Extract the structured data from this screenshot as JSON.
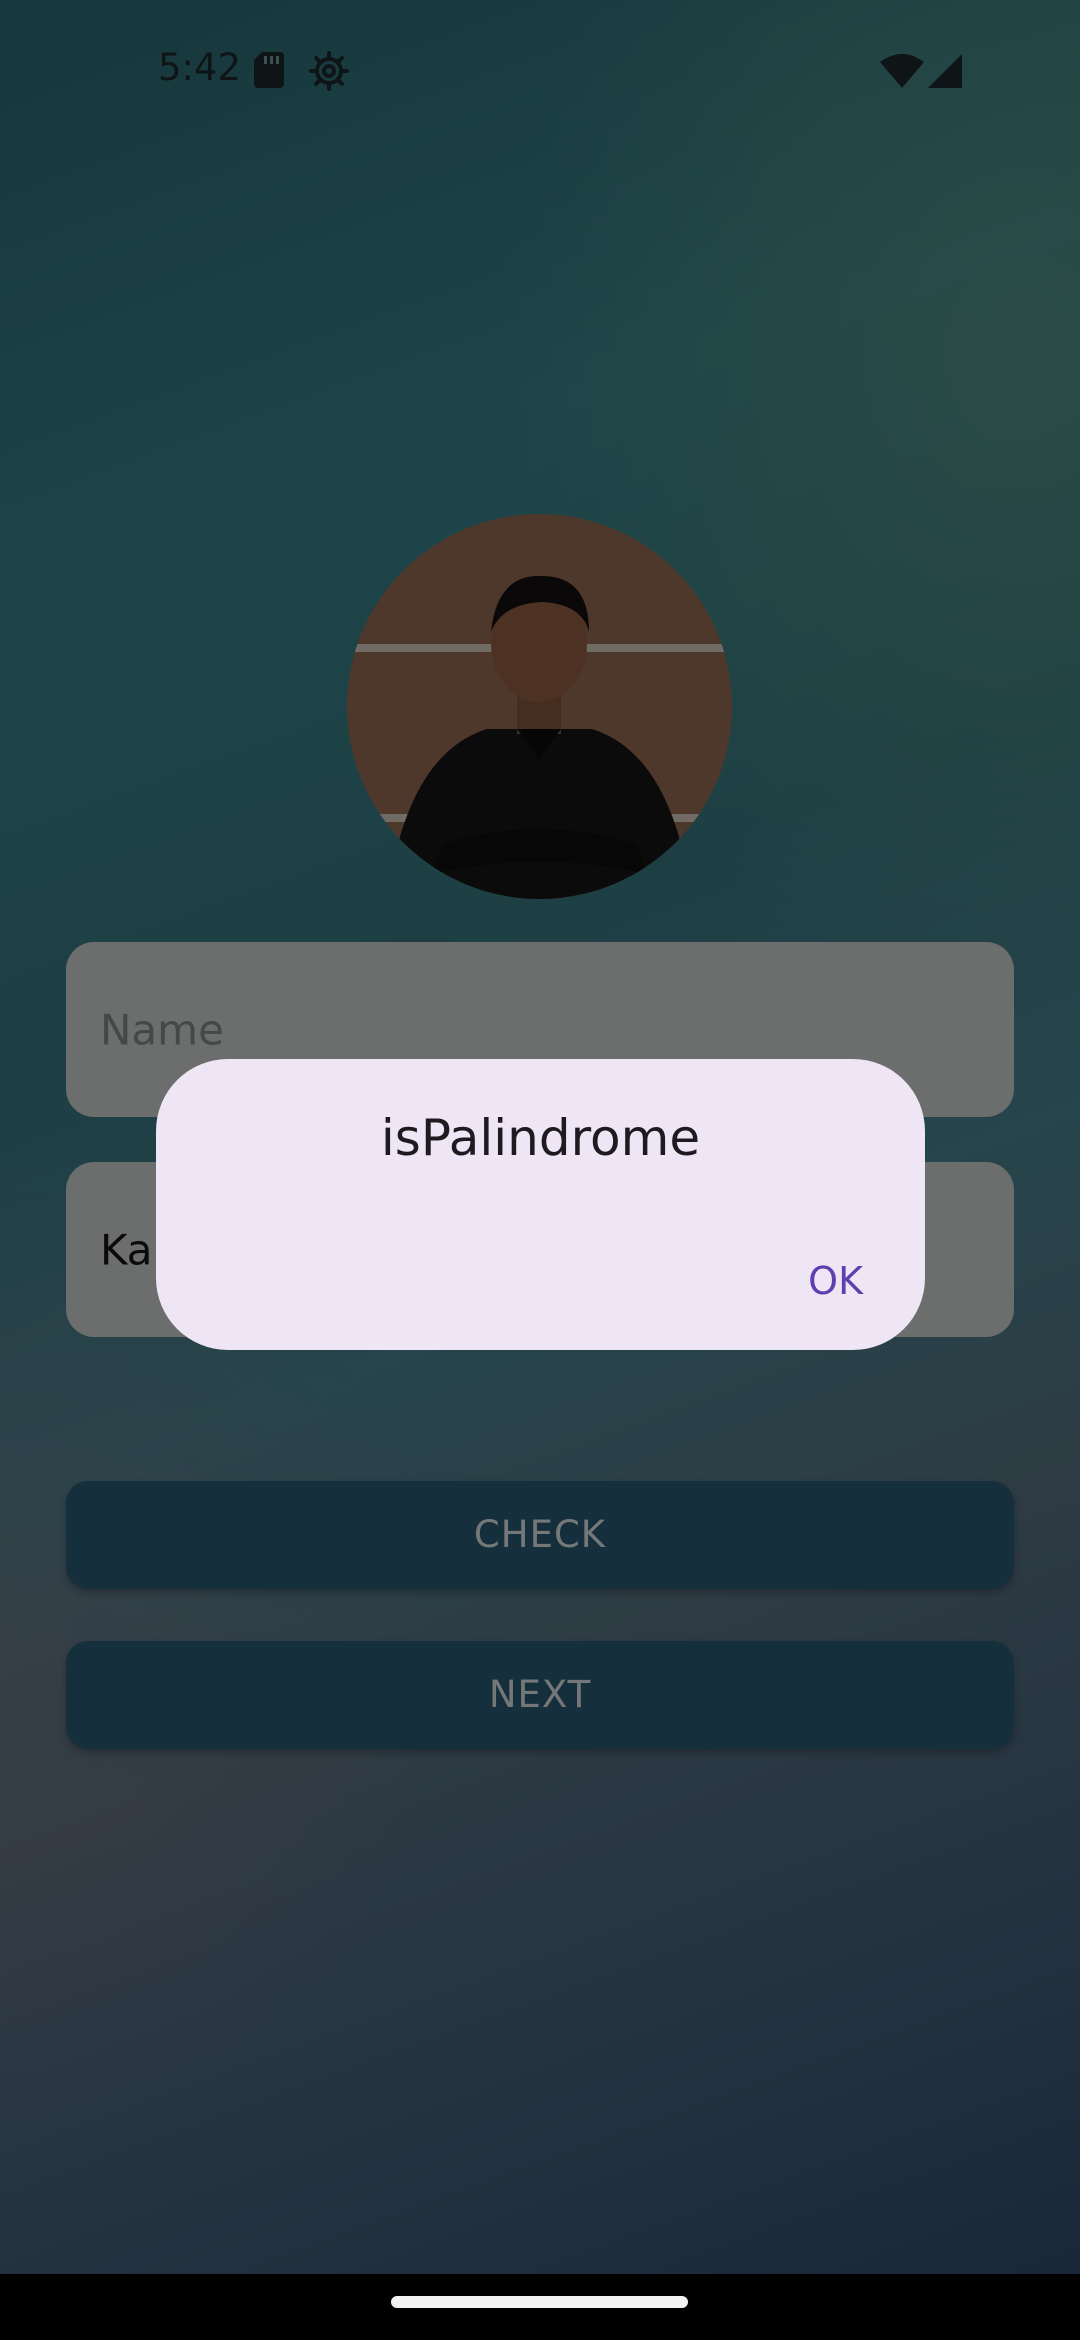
{
  "status_bar": {
    "time": "5:42",
    "icons": [
      "sd-card-icon",
      "gear-icon",
      "wifi-icon",
      "signal-icon"
    ]
  },
  "profile": {
    "avatar": "profile-photo"
  },
  "form": {
    "name_placeholder": "Name",
    "sentence_value": "Ka"
  },
  "buttons": {
    "check_label": "CHECK",
    "next_label": "NEXT"
  },
  "dialog": {
    "title": "isPalindrome",
    "ok_label": "OK"
  },
  "colors": {
    "dialog_bg": "#efe6f5",
    "accent": "#5d3fae",
    "button_bg": "#2b5f78"
  }
}
